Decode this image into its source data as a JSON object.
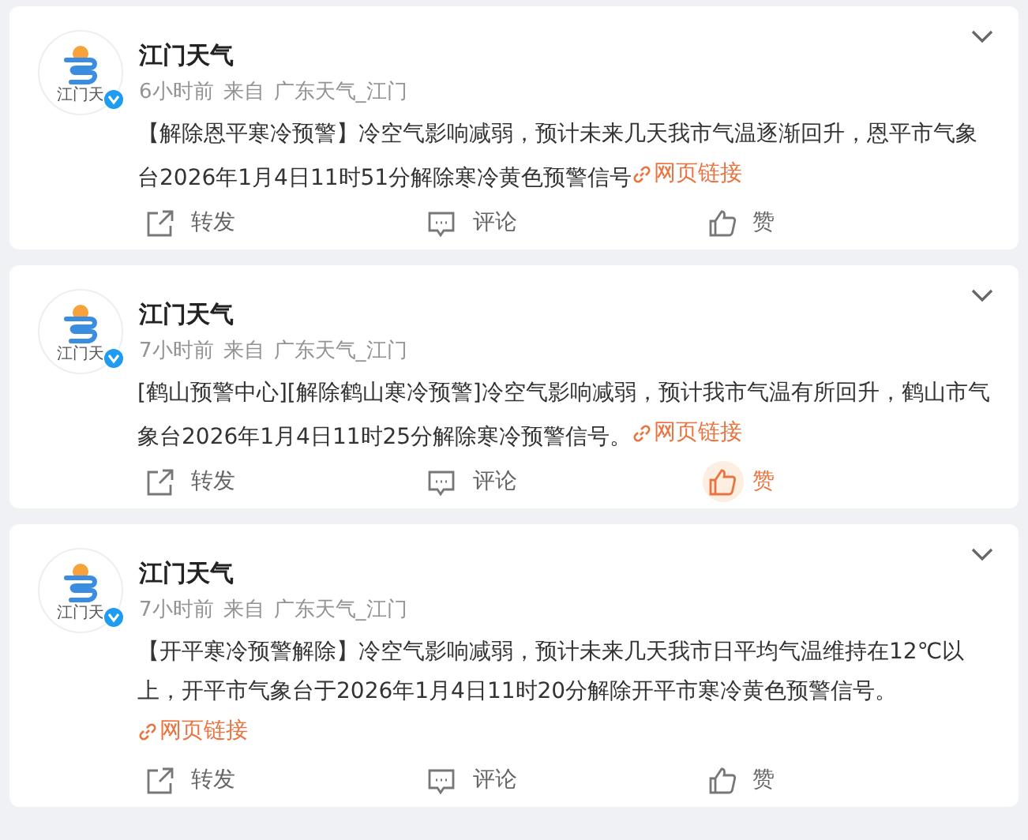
{
  "posts": [
    {
      "author": "江门天气",
      "avatar_caption": "江门天",
      "time": "6小时前",
      "source_prefix": "来自",
      "source": "广东天气_江门",
      "text": "【解除恩平寒冷预警】冷空气影响减弱，预计未来几天我市气温逐渐回升，恩平市气象台2026年1月4日11时51分解除寒冷黄色预警信号",
      "link": "网页链接",
      "actions": {
        "repost": "转发",
        "comment": "评论",
        "like": "赞"
      },
      "liked": false
    },
    {
      "author": "江门天气",
      "avatar_caption": "江门天",
      "time": "7小时前",
      "source_prefix": "来自",
      "source": "广东天气_江门",
      "text": "[鹤山预警中心][解除鹤山寒冷预警]冷空气影响减弱，预计我市气温有所回升，鹤山市气象台2026年1月4日11时25分解除寒冷预警信号。",
      "link": "网页链接",
      "actions": {
        "repost": "转发",
        "comment": "评论",
        "like": "赞"
      },
      "liked": true
    },
    {
      "author": "江门天气",
      "avatar_caption": "江门天",
      "time": "7小时前",
      "source_prefix": "来自",
      "source": "广东天气_江门",
      "text": "【开平寒冷预警解除】冷空气影响减弱，预计未来几天我市日平均气温维持在12℃以上，开平市气象台于2026年1月4日11时20分解除开平市寒冷黄色预警信号。",
      "link": "网页链接",
      "actions": {
        "repost": "转发",
        "comment": "评论",
        "like": "赞"
      },
      "liked": false
    }
  ]
}
